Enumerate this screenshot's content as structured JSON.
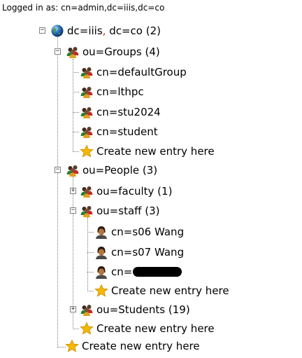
{
  "login": {
    "text": "Logged in as: cn=admin,dc=iiis,dc=co"
  },
  "tree": {
    "root": {
      "dn_part1": "dc=iiis",
      "separator": ",",
      "dn_part2": " dc=co",
      "count": " (2)",
      "toggle": "−",
      "icon": "globe-icon"
    },
    "groups": {
      "label": "ou=Groups (4)",
      "toggle": "−",
      "icon": "group-icon",
      "children": [
        {
          "label": "cn=defaultGroup",
          "icon": "group-icon"
        },
        {
          "label": "cn=lthpc",
          "icon": "group-icon"
        },
        {
          "label": "cn=stu2024",
          "icon": "group-icon"
        },
        {
          "label": "cn=student",
          "icon": "group-icon"
        }
      ],
      "create": "Create new entry here"
    },
    "people": {
      "label": "ou=People (3)",
      "toggle": "−",
      "icon": "group-icon",
      "faculty": {
        "label": "ou=faculty (1)",
        "toggle": "+",
        "icon": "group-icon"
      },
      "staff": {
        "label": "ou=staff (3)",
        "toggle": "−",
        "icon": "group-icon",
        "children": [
          {
            "label": "cn=s06 Wang",
            "icon": "user-icon"
          },
          {
            "label": "cn=s07 Wang",
            "icon": "user-icon"
          },
          {
            "label": "cn=",
            "icon": "user-icon",
            "redacted": true
          }
        ],
        "create": "Create new entry here"
      },
      "students": {
        "label": "ou=Students (19)",
        "toggle": "+",
        "icon": "group-icon"
      },
      "create": "Create new entry here"
    },
    "root_create": "Create new entry here"
  },
  "colors": {
    "star": "#f5b800",
    "globe": "#2a6fc9",
    "link_sep": "#d02020"
  }
}
